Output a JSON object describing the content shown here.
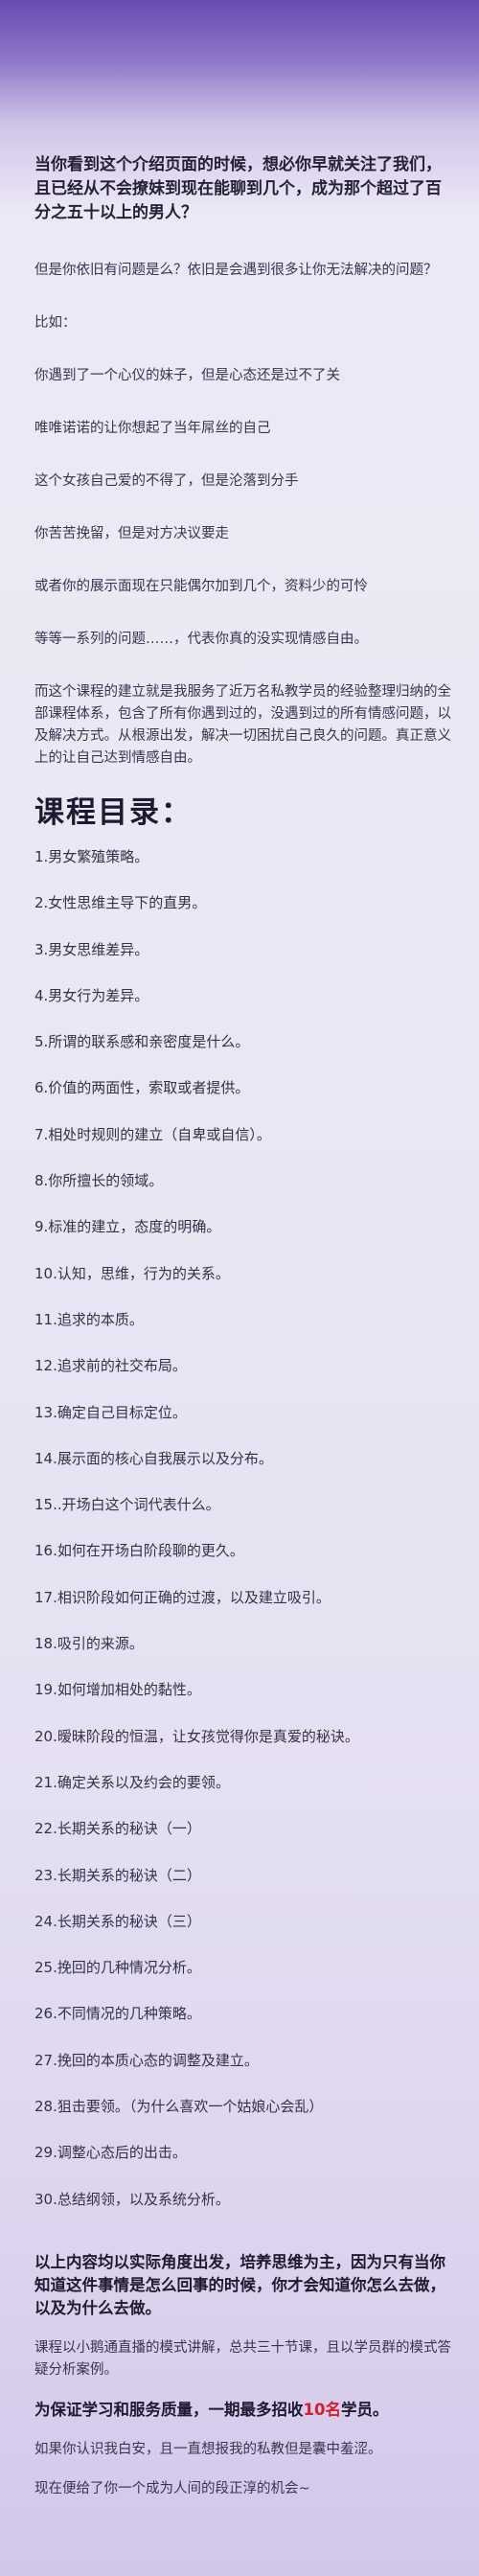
{
  "intro": {
    "lead": "当你看到这个介绍页面的时候，想必你早就关注了我们，且已经从不会撩妹到现在能聊到几个，成为那个超过了百分之五十以上的男人？",
    "question": "但是你依旧有问题是么？依旧是会遇到很多让你无法解决的问题？",
    "for_example": "比如：",
    "examples": [
      "你遇到了一个心仪的妹子，但是心态还是过不了关",
      "唯唯诺诺的让你想起了当年屌丝的自己",
      "这个女孩自己爱的不得了，但是沦落到分手",
      "你苦苦挽留，但是对方决议要走",
      "或者你的展示面现在只能偶尔加到几个，资料少的可怜",
      "等等一系列的问题……，代表你真的没实现情感自由。"
    ],
    "course_desc": "而这个课程的建立就是我服务了近万名私教学员的经验整理归纳的全部课程体系，包含了所有你遇到过的，没遇到过的所有情感问题，以及解决方式。从根源出发，解决一切困扰自己良久的问题。真正意义上的让自己达到情感自由。"
  },
  "catalog": {
    "title": "课程目录：",
    "items": [
      "1.男女繁殖策略。",
      "2.女性思维主导下的直男。",
      "3.男女思维差异。",
      "4.男女行为差异。",
      "5.所谓的联系感和亲密度是什么。",
      "6.价值的两面性，索取或者提供。",
      "7.相处时规则的建立（自卑或自信）。",
      "8.你所擅长的领域。",
      "9.标准的建立，态度的明确。",
      "10.认知，思维，行为的关系。",
      "11.追求的本质。",
      "12.追求前的社交布局。",
      "13.确定自己目标定位。",
      "14.展示面的核心自我展示以及分布。",
      "15..开场白这个词代表什么。",
      "16.如何在开场白阶段聊的更久。",
      "17.相识阶段如何正确的过渡，以及建立吸引。",
      "18.吸引的来源。",
      "19.如何增加相处的黏性。",
      "20.暧昧阶段的恒温，让女孩觉得你是真爱的秘诀。",
      "21.确定关系以及约会的要领。",
      "22.长期关系的秘诀（一）",
      "23.长期关系的秘诀（二）",
      "24.长期关系的秘诀（三）",
      "25.挽回的几种情况分析。",
      "26.不同情况的几种策略。",
      "27.挽回的本质心态的调整及建立。",
      "28.狙击要领。（为什么喜欢一个姑娘心会乱）",
      "29.调整心态后的出击。",
      "30.总结纲领，以及系统分析。"
    ]
  },
  "outro": {
    "summary": "以上内容均以实际角度出发，培养思维为主，因为只有当你知道这件事情是怎么回事的时候，你才会知道你怎么去做，以及为什么去做。",
    "format": "课程以小鹅通直播的模式讲解，总共三十节课，且以学员群的模式答疑分析案例。",
    "limit_prefix": "为保证学习和服务质量，一期最多招收",
    "limit_highlight": "10名",
    "limit_suffix": "学员。",
    "shy": "如果你认识我白安，且一直想报我的私教但是囊中羞涩。",
    "closing": "现在便给了你一个成为人间的段正淳的机会~"
  },
  "colors": {
    "header_purple": "#6a4bb0",
    "highlight_red": "#d81e2c"
  }
}
